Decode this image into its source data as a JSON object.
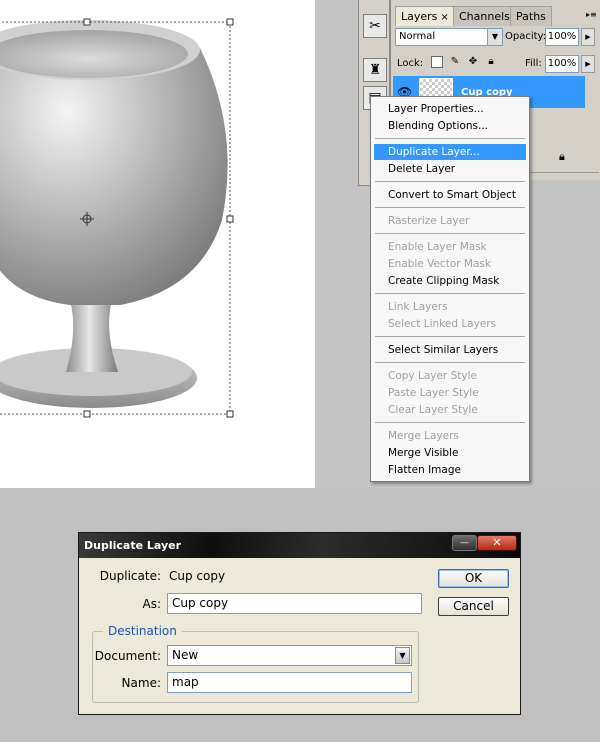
{
  "layers_panel": {
    "tabs": [
      {
        "label": "Layers",
        "close": "×"
      },
      {
        "label": "Channels"
      },
      {
        "label": "Paths"
      }
    ],
    "blend_mode": "Normal",
    "opacity_label": "Opacity:",
    "opacity_value": "100%",
    "lock_label": "Lock:",
    "fill_label": "Fill:",
    "fill_value": "100%",
    "layer_name": "Cup copy"
  },
  "context_menu": {
    "items": [
      {
        "label": "Layer Properties...",
        "enabled": true
      },
      {
        "label": "Blending Options...",
        "enabled": true
      },
      {
        "label": "Duplicate Layer...",
        "enabled": true,
        "highlighted": true
      },
      {
        "label": "Delete Layer",
        "enabled": true
      },
      {
        "label": "Convert to Smart Object",
        "enabled": true
      },
      {
        "label": "Rasterize Layer",
        "enabled": false
      },
      {
        "label": "Enable Layer Mask",
        "enabled": false
      },
      {
        "label": "Enable Vector Mask",
        "enabled": false
      },
      {
        "label": "Create Clipping Mask",
        "enabled": true
      },
      {
        "label": "Link Layers",
        "enabled": false
      },
      {
        "label": "Select Linked Layers",
        "enabled": false
      },
      {
        "label": "Select Similar Layers",
        "enabled": true
      },
      {
        "label": "Copy Layer Style",
        "enabled": false
      },
      {
        "label": "Paste Layer Style",
        "enabled": false
      },
      {
        "label": "Clear Layer Style",
        "enabled": false
      },
      {
        "label": "Merge Layers",
        "enabled": false
      },
      {
        "label": "Merge Visible",
        "enabled": true
      },
      {
        "label": "Flatten Image",
        "enabled": true
      }
    ]
  },
  "dialog": {
    "title": "Duplicate Layer",
    "duplicate_label": "Duplicate:",
    "duplicate_value": "Cup copy",
    "as_label": "As:",
    "as_value": "Cup copy",
    "destination_label": "Destination",
    "document_label": "Document:",
    "document_value": "New",
    "name_label": "Name:",
    "name_value": "map",
    "ok_label": "OK",
    "cancel_label": "Cancel",
    "close_glyph": "✕",
    "minimize_glyph": "—"
  },
  "colors": {
    "highlight": "#3399ff",
    "dialog_bg": "#ece9d8",
    "destination_text": "#1f52b5"
  },
  "icons": {
    "tools": [
      "tools-crossed-icon",
      "puppet-icon",
      "layers-small-icon"
    ],
    "lock": [
      "lock-transparent-icon",
      "lock-brush-icon",
      "lock-move-icon",
      "lock-all-icon"
    ]
  }
}
